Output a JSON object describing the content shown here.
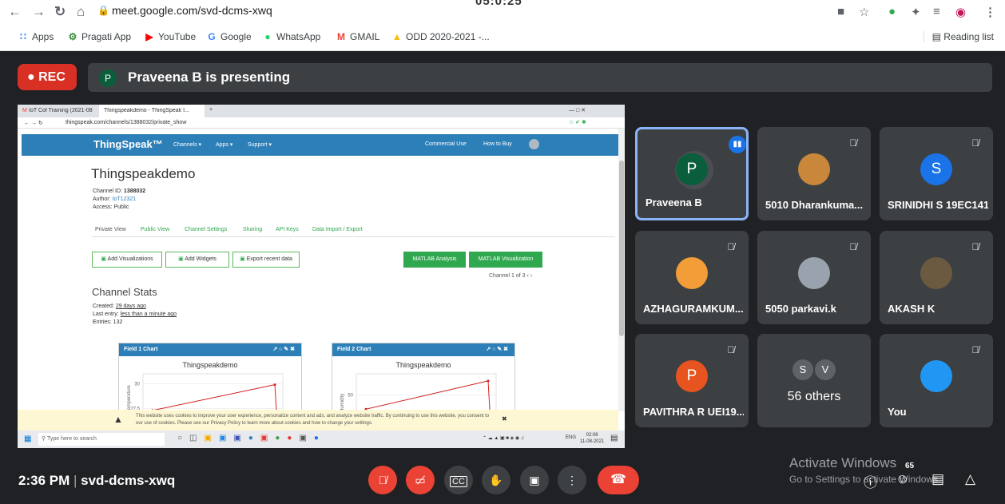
{
  "top_clock": "05:0:25",
  "browser": {
    "url": "meet.google.com/svd-dcms-xwq",
    "bookmarks": [
      "Apps",
      "Pragati App",
      "YouTube",
      "Google",
      "WhatsApp",
      "GMAIL",
      "ODD 2020-2021 -..."
    ],
    "reading_list": "Reading list"
  },
  "meet": {
    "rec_label": "REC",
    "presenter_initial": "P",
    "presenting_text": "Praveena B is presenting",
    "time": "2:36 PM",
    "separator": "|",
    "meeting_code": "svd-dcms-xwq",
    "participant_count": "65",
    "watermark_title": "Activate Windows",
    "watermark_sub": "Go to Settings to activate Windows."
  },
  "shared": {
    "tab1": "IoT Cof Training (2021-08-10 ...",
    "tab2": "Thingspeakdemo - ThingSpeak I...",
    "address": "thingspeak.com/channels/1388032/private_show",
    "brand": "ThingSpeak™",
    "nav": [
      "Channels ▾",
      "Apps ▾",
      "Support ▾"
    ],
    "nav_right": [
      "Commercial Use",
      "How to Buy"
    ],
    "channel_title": "Thingspeakdemo",
    "channel_id_label": "Channel ID:",
    "channel_id": "1388032",
    "author_label": "Author:",
    "author": "IoT12321",
    "access": "Access: Public",
    "tabs": [
      "Private View",
      "Public View",
      "Channel Settings",
      "Sharing",
      "API Keys",
      "Data Import / Export"
    ],
    "buttons": [
      "Add Visualizations",
      "Add Widgets",
      "Export recent data"
    ],
    "green_buttons": [
      "MATLAB Analysis",
      "MATLAB Visualization"
    ],
    "channel_pager": "Channel 1 of 3 ‹ ›",
    "stats_title": "Channel Stats",
    "created_label": "Created:",
    "created": "29 days ago",
    "last_entry_label": "Last entry:",
    "last_entry": "less than a minute ago",
    "entries": "Entries: 132",
    "field1_title": "Field 1 Chart",
    "field2_title": "Field 2 Chart",
    "chart_title": "Thingspeakdemo",
    "field1_ylabel": "Temperature",
    "field2_ylabel": "Humidity",
    "cookie_text": "This website uses cookies to improve your user experience, personalize content and ads, and analyze website traffic. By continuing to use this website, you consent to our use of cookies. Please see our Privacy Policy to learn more about cookies and how to change your settings.",
    "search_placeholder": "Type here to search",
    "sys_time": "02:06",
    "sys_date": "11-08-2021",
    "sys_lang": "ENG"
  },
  "chart_data": [
    {
      "type": "line",
      "title": "Thingspeakdemo",
      "ylabel": "Temperature",
      "yticks": [
        "30",
        "27.5"
      ],
      "x": [
        0,
        1
      ],
      "series": [
        {
          "values": [
            27.3,
            29.9
          ]
        }
      ]
    },
    {
      "type": "line",
      "title": "Thingspeakdemo",
      "ylabel": "Humidity",
      "yticks": [
        "50"
      ],
      "x": [
        0,
        1
      ],
      "series": [
        {
          "values": [
            40,
            60
          ]
        }
      ]
    }
  ],
  "tiles": [
    {
      "name": "Praveena B",
      "initial": "P",
      "color": "#0b5e3b",
      "kind": "initial",
      "muted": false,
      "active": true
    },
    {
      "name": "5010 Dharankuma...",
      "initial": "",
      "color": "#c8873a",
      "kind": "photo",
      "muted": true
    },
    {
      "name": "SRINIDHI S 19EC141",
      "initial": "S",
      "color": "#1a73e8",
      "kind": "initial",
      "muted": true
    },
    {
      "name": "AZHAGURAMKUM...",
      "initial": "",
      "color": "#f29d38",
      "kind": "photo",
      "muted": true
    },
    {
      "name": "5050 parkavi.k",
      "initial": "",
      "color": "#9aa3ad",
      "kind": "photo",
      "muted": true
    },
    {
      "name": "AKASH K",
      "initial": "",
      "color": "#6b5a3f",
      "kind": "photo",
      "muted": true
    },
    {
      "name": "PAVITHRA R UEI19...",
      "initial": "P",
      "color": "#e8541f",
      "kind": "initial",
      "muted": true
    },
    {
      "name": "56 others",
      "initial": "",
      "color": "",
      "kind": "others",
      "muted": false,
      "others": [
        "S",
        "V"
      ]
    },
    {
      "name": "You",
      "initial": "",
      "color": "#2196f3",
      "kind": "photo",
      "muted": true
    }
  ]
}
